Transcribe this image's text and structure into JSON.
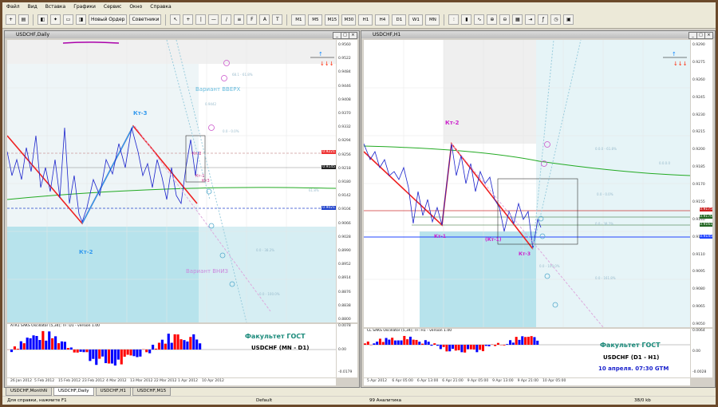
{
  "menu": [
    "Файл",
    "Вид",
    "Вставка",
    "Графики",
    "Сервис",
    "Окно",
    "Справка"
  ],
  "toolbar": {
    "new_order": "Новый Ордер",
    "advisors": "Советники",
    "timeframes": [
      "M1",
      "M5",
      "M15",
      "M30",
      "H1",
      "H4",
      "D1",
      "W1",
      "MN"
    ]
  },
  "left": {
    "title": "USDCHF,Daily",
    "prices": [
      "0.9560",
      "0.9522",
      "0.9484",
      "0.9446",
      "0.9408",
      "0.9370",
      "0.9332",
      "0.9294",
      "0.9256",
      "0.9218",
      "0.9180",
      "0.9142",
      "0.9104",
      "0.9066",
      "0.9028",
      "0.8990",
      "0.8952",
      "0.8914",
      "0.8876",
      "0.8838",
      "0.8800"
    ],
    "price_tag1": "0.9221",
    "price_tag2": "0.9145",
    "price_tag3": "0.9021",
    "dates": [
      "26 Jan 2012",
      "5 Feb 2012",
      "15 Feb 2012",
      "23 Feb 2012",
      "4 Mar 2012",
      "13 Mar 2012",
      "22 Mar 2012",
      "1 Apr 2012",
      "10 Apr 2012"
    ],
    "labels": {
      "kt3": "Кт-3",
      "kt2": "Кт-2",
      "kt2s": "Кт-2",
      "kt3s": "Кт3",
      "kt1": "Кт-1",
      "var_up": "Вариант ВВЕРХ",
      "var_down": "Вариант ВНИЗ",
      "fibo1": "0.0.0.0",
      "fibo2": "61.8%"
    },
    "osc_label": "ATR1 SAKS Oscillator (5,34); TF: D1 - version 1.00",
    "osc_vals": [
      "0.0078",
      "0.00",
      "-0.0179"
    ],
    "brand": "Факультет ГОСТ",
    "pair": "USDCHF (MN - D1)"
  },
  "right": {
    "title": "USDCHF,H1",
    "prices": [
      "0.9290",
      "0.9275",
      "0.9260",
      "0.9245",
      "0.9230",
      "0.9215",
      "0.9200",
      "0.9185",
      "0.9170",
      "0.9155",
      "0.9140",
      "0.9125",
      "0.9110",
      "0.9095",
      "0.9080",
      "0.9065",
      "0.9050"
    ],
    "price_tags": [
      "0.9175",
      "0.9170",
      "0.9161",
      "0.9145"
    ],
    "dates": [
      "5 Apr 2012",
      "6 Apr 05:00",
      "6 Apr 13:00",
      "6 Apr 21:00",
      "9 Apr 05:00",
      "9 Apr 13:00",
      "9 Apr 21:00",
      "10 Apr 05:00"
    ],
    "labels": {
      "kt2": "Кт-2",
      "kt1": "Кт-1",
      "kt1b": "(Кт-1)",
      "kt3": "Кт-3"
    },
    "osc_label": "CL SAKS Oscillator (5,34); TF: H1 - version 1.00",
    "osc_vals": [
      "0.0064",
      "0.00",
      "-0.0028"
    ],
    "brand": "Факультет ГОСТ",
    "pair": "USDCHF (D1 - H1)",
    "date": "10 апреля. 07:30 GTM"
  },
  "tabs": [
    "USDCHF,MonthN",
    "USDCHF,Daily",
    "USDCHF,H1",
    "USDCHF,M15"
  ],
  "status": {
    "help": "Для справки, нажмите F1",
    "default": "Default",
    "analytics": "99 Аналитика",
    "kb": "38/0 kb"
  },
  "colors": {
    "up": "#ff0000",
    "down": "#0000ff",
    "cyan": "#b7e3ec",
    "ma": "#22aa22"
  }
}
